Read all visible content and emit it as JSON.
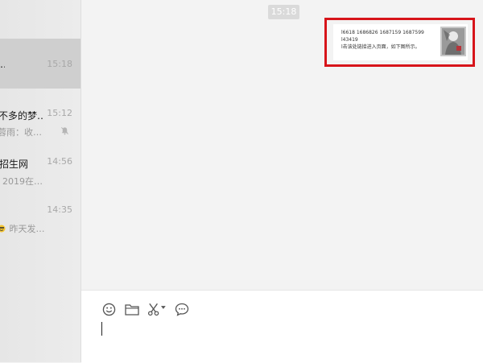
{
  "conversations": [
    {
      "title": "…",
      "time": "15:18",
      "preview": "",
      "selected": true
    },
    {
      "title": "不多的梦…",
      "time": "15:12",
      "preview": "蓉雨：收…",
      "muted": true
    },
    {
      "title": "招生网",
      "time": "14:56",
      "preview": "2019在…"
    },
    {
      "title": "",
      "time": "14:35",
      "preview": "昨天发…",
      "has_emoji": true
    }
  ],
  "chat": {
    "time_divider": "15:18",
    "message_card": {
      "line1": "l6618 1686826  1687159  1687599",
      "line2": "l43419",
      "line3": "l击该处链接进入页面，如下图所示。"
    }
  },
  "composer": {
    "tools": [
      "emoji-icon",
      "folder-icon",
      "scissors-icon",
      "chat-bubble-icon"
    ],
    "text": ""
  },
  "colors": {
    "highlight": "#d7141a",
    "selected_row": "#cfcfcf",
    "icon": "#555555"
  }
}
